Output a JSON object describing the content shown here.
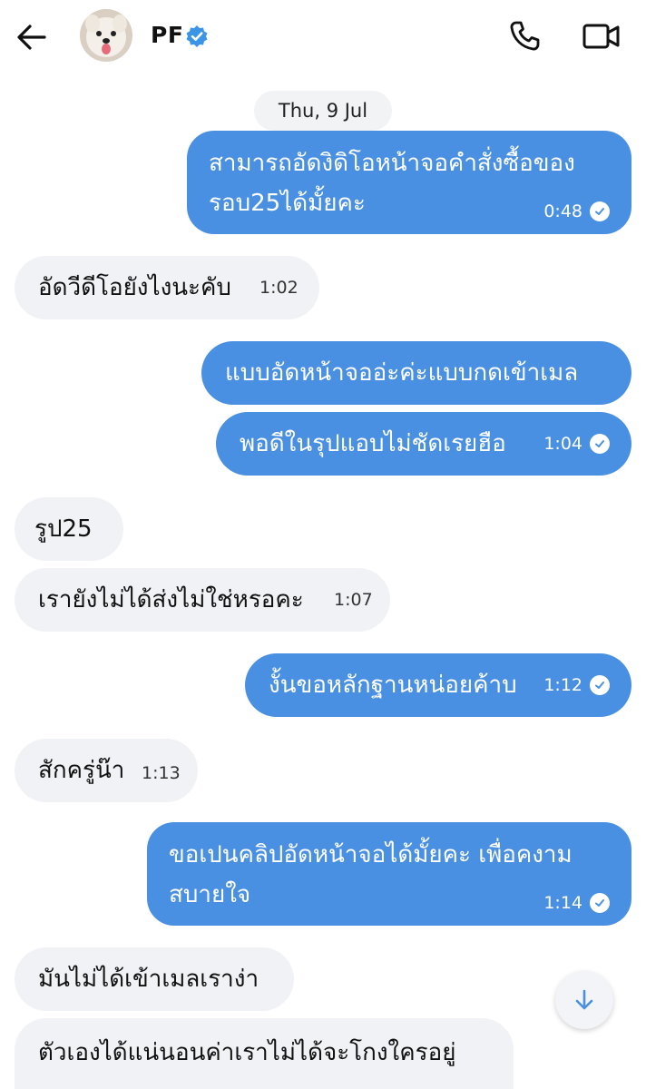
{
  "header": {
    "contact_name": "PF",
    "back_icon": "arrow-left-icon",
    "verified_icon": "verified-badge-icon",
    "call_icon": "phone-icon",
    "video_icon": "video-camera-icon"
  },
  "date_separator": "Thu, 9 Jul",
  "messages": [
    {
      "direction": "out",
      "lines": [
        "สามารถอัดงิดิโอหน้าจอคำสั่งซื้อของ",
        "รอบ25ได้มั้ยคะ"
      ],
      "time": "0:48",
      "read": true
    },
    {
      "direction": "in",
      "lines": [
        "อัดวีดีโอยังไงนะคับ"
      ],
      "time": "1:02"
    },
    {
      "direction": "out",
      "lines": [
        "แบบอัดหน้าจออ่ะค่ะแบบกดเข้าเมล"
      ],
      "time": ""
    },
    {
      "direction": "out",
      "lines": [
        "พอดีในรุปแอบไม่ชัดเรยฮือ"
      ],
      "time": "1:04",
      "read": true
    },
    {
      "direction": "in",
      "lines": [
        "รูป25"
      ],
      "time": ""
    },
    {
      "direction": "in",
      "lines": [
        "เรายังไม่ได้ส่งไม่ใช่หรอคะ"
      ],
      "time": "1:07"
    },
    {
      "direction": "out",
      "lines": [
        "งั้นขอหลักฐานหน่อยค้าบ"
      ],
      "time": "1:12",
      "read": true
    },
    {
      "direction": "in",
      "lines": [
        "สักครู่น๊า"
      ],
      "time": "1:13"
    },
    {
      "direction": "out",
      "lines": [
        "ขอเปนคลิปอัดหน้าจอได้มั้ยคะ เพื่อคงาม",
        "สบายใจ"
      ],
      "time": "1:14",
      "read": true
    },
    {
      "direction": "in",
      "lines": [
        "มันไม่ได้เข้าเมลเราง่า"
      ],
      "time": ""
    },
    {
      "direction": "in",
      "lines": [
        "ตัวเองได้แน่นอนค่าเราไม่ได้จะโกงใครอยู่"
      ],
      "time": ""
    }
  ],
  "colors": {
    "outgoing_bubble": "#4a90e2",
    "incoming_bubble": "#f0f2f5",
    "verified_badge": "#3b94e6"
  },
  "scroll_down_icon": "arrow-down-icon"
}
